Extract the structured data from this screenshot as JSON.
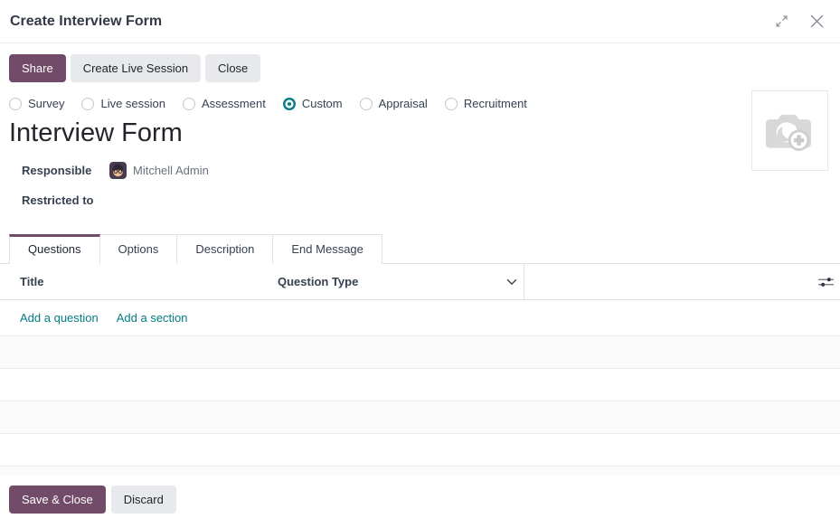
{
  "dialog": {
    "title": "Create Interview Form"
  },
  "toolbar": {
    "share_label": "Share",
    "create_live_session_label": "Create Live Session",
    "close_label": "Close"
  },
  "survey_type": {
    "options": [
      {
        "label": "Survey",
        "selected": false
      },
      {
        "label": "Live session",
        "selected": false
      },
      {
        "label": "Assessment",
        "selected": false
      },
      {
        "label": "Custom",
        "selected": true
      },
      {
        "label": "Appraisal",
        "selected": false
      },
      {
        "label": "Recruitment",
        "selected": false
      }
    ]
  },
  "form": {
    "survey_title": "Interview Form",
    "responsible_label": "Responsible",
    "responsible_value": "Mitchell Admin",
    "restricted_to_label": "Restricted to"
  },
  "tabs": [
    {
      "label": "Questions",
      "active": true
    },
    {
      "label": "Options",
      "active": false
    },
    {
      "label": "Description",
      "active": false
    },
    {
      "label": "End Message",
      "active": false
    }
  ],
  "questions": {
    "columns": {
      "title": "Title",
      "question_type": "Question Type"
    },
    "add_question_label": "Add a question",
    "add_section_label": "Add a section"
  },
  "footer": {
    "save_label": "Save & Close",
    "discard_label": "Discard"
  },
  "icons": {
    "expand": "expand-icon",
    "close": "close-icon",
    "chevron_down": "chevron-down-icon",
    "optional_columns": "sliders-icon",
    "camera_add": "camera-add-icon"
  },
  "colors": {
    "primary": "#714B67",
    "accent_teal": "#017E84",
    "secondary_button_bg": "#e7e9ed",
    "border": "#dee2e6",
    "stripe": "#fafafa"
  }
}
